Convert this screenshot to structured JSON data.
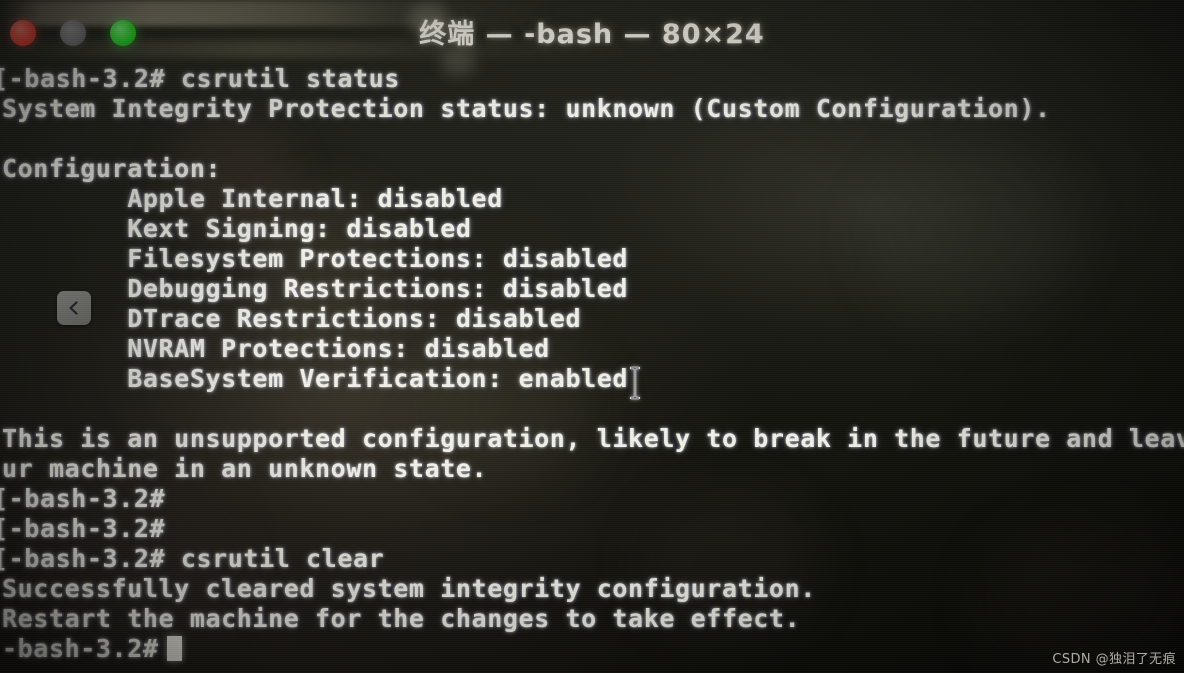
{
  "window": {
    "title": "终端 — -bash — 80×24",
    "traffic_lights": [
      {
        "name": "close",
        "color": "#ef4a3c",
        "label": "close"
      },
      {
        "name": "minimize",
        "color": "#7a7a7a",
        "label": "minimize"
      },
      {
        "name": "zoom",
        "color": "#2ce02c",
        "label": "zoom"
      }
    ]
  },
  "terminal": {
    "lines": [
      {
        "text": "[-bash-3.2# csrutil status",
        "clipped": true
      },
      {
        "text": "System Integrity Protection status: unknown (Custom Configuration).",
        "clipped": false
      },
      {
        "text": "",
        "clipped": false
      },
      {
        "text": "Configuration:",
        "clipped": false
      },
      {
        "text": "        Apple Internal: disabled",
        "clipped": false
      },
      {
        "text": "        Kext Signing: disabled",
        "clipped": false
      },
      {
        "text": "        Filesystem Protections: disabled",
        "clipped": false
      },
      {
        "text": "        Debugging Restrictions: disabled",
        "clipped": false
      },
      {
        "text": "        DTrace Restrictions: disabled",
        "clipped": false
      },
      {
        "text": "        NVRAM Protections: disabled",
        "clipped": false
      },
      {
        "text": "        BaseSystem Verification: enabled",
        "clipped": false
      },
      {
        "text": "",
        "clipped": false
      },
      {
        "text": "This is an unsupported configuration, likely to break in the future and leave y",
        "clipped": false
      },
      {
        "text": "ur machine in an unknown state.",
        "clipped": false
      },
      {
        "text": "[-bash-3.2#",
        "clipped": true
      },
      {
        "text": "[-bash-3.2#",
        "clipped": true
      },
      {
        "text": "[-bash-3.2# csrutil clear",
        "clipped": true
      },
      {
        "text": "Successfully cleared system integrity configuration.",
        "clipped": false
      },
      {
        "text": "Restart the machine for the changes to take effect.",
        "clipped": false
      }
    ],
    "prompt": "-bash-3.2#",
    "cursor": "block"
  },
  "overlay": {
    "back_button_label": "back",
    "text_cursor_label": "I-beam text cursor"
  },
  "watermark": {
    "text": "CSDN @独泪了无痕"
  }
}
